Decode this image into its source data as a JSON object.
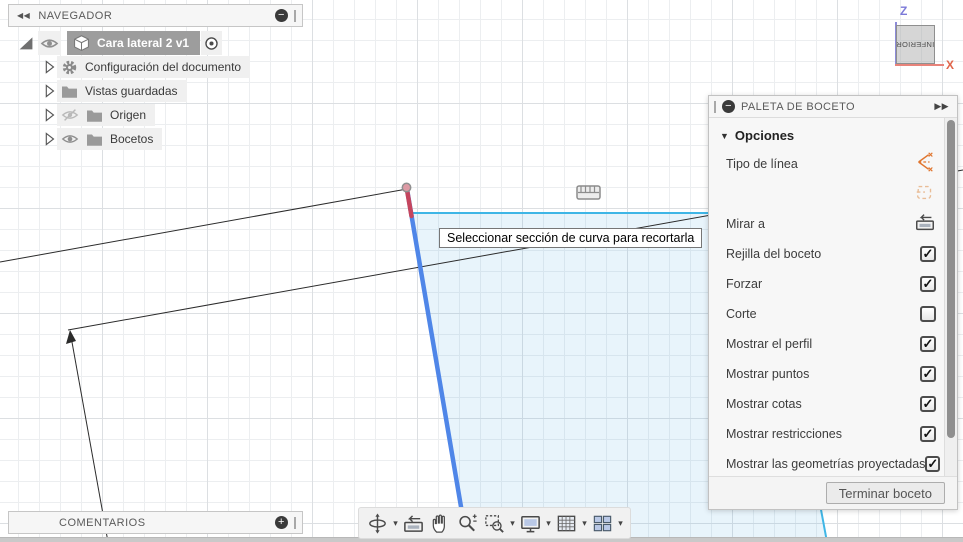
{
  "icons": {
    "collapse_left": "◀◀",
    "expand_right": "▶▶",
    "caret_down": "▼",
    "dropdown_caret": "▾",
    "minus_glyph": "−",
    "plus_glyph": "+"
  },
  "navigator": {
    "title": "NAVEGADOR",
    "items": [
      {
        "label": "Cara lateral 2 v1",
        "selected": true,
        "visible": true
      },
      {
        "label": "Configuración del documento"
      },
      {
        "label": "Vistas guardadas"
      },
      {
        "label": "Origen",
        "visible": false
      },
      {
        "label": "Bocetos",
        "visible": true
      }
    ]
  },
  "comments": {
    "title": "COMENTARIOS"
  },
  "viewcube": {
    "face": "INFERIOR",
    "x_label": "X",
    "z_label": "Z"
  },
  "tooltip": {
    "text": "Seleccionar sección de curva para recortarla"
  },
  "palette": {
    "title": "PALETA DE BOCETO",
    "section": "Opciones",
    "rows": [
      {
        "label": "Tipo de línea",
        "control": "icon",
        "icon": "line-type-icon"
      },
      {
        "label": "",
        "control": "icon",
        "icon": "sketch-scale-icon"
      },
      {
        "label": "Mirar a",
        "control": "icon",
        "icon": "look-at-icon"
      },
      {
        "label": "Rejilla del boceto",
        "control": "checkbox",
        "checked": true
      },
      {
        "label": "Forzar",
        "control": "checkbox",
        "checked": true
      },
      {
        "label": "Corte",
        "control": "checkbox",
        "checked": false
      },
      {
        "label": "Mostrar el perfil",
        "control": "checkbox",
        "checked": true
      },
      {
        "label": "Mostrar puntos",
        "control": "checkbox",
        "checked": true
      },
      {
        "label": "Mostrar cotas",
        "control": "checkbox",
        "checked": true
      },
      {
        "label": "Mostrar restricciones",
        "control": "checkbox",
        "checked": true
      },
      {
        "label": "Mostrar las geometrías proyectadas",
        "control": "checkbox",
        "checked": true
      }
    ],
    "finish_button": "Terminar boceto"
  },
  "toolbar": {
    "buttons": [
      "orbit",
      "look-at",
      "pan",
      "zoom",
      "zoom-window",
      "display-settings",
      "grid-display",
      "viewports"
    ]
  },
  "colors": {
    "selection_blue": "#4f86e8",
    "highlight_red": "#c5455e",
    "profile_fill_rgba": "rgba(100,180,230,0.15)",
    "cyan_line": "#3fb6e6",
    "axis_x": "#e0654a",
    "axis_z": "#7b79d8",
    "accent_orange": "#e0752e",
    "selected_row_gray": "#9d9d9d"
  }
}
